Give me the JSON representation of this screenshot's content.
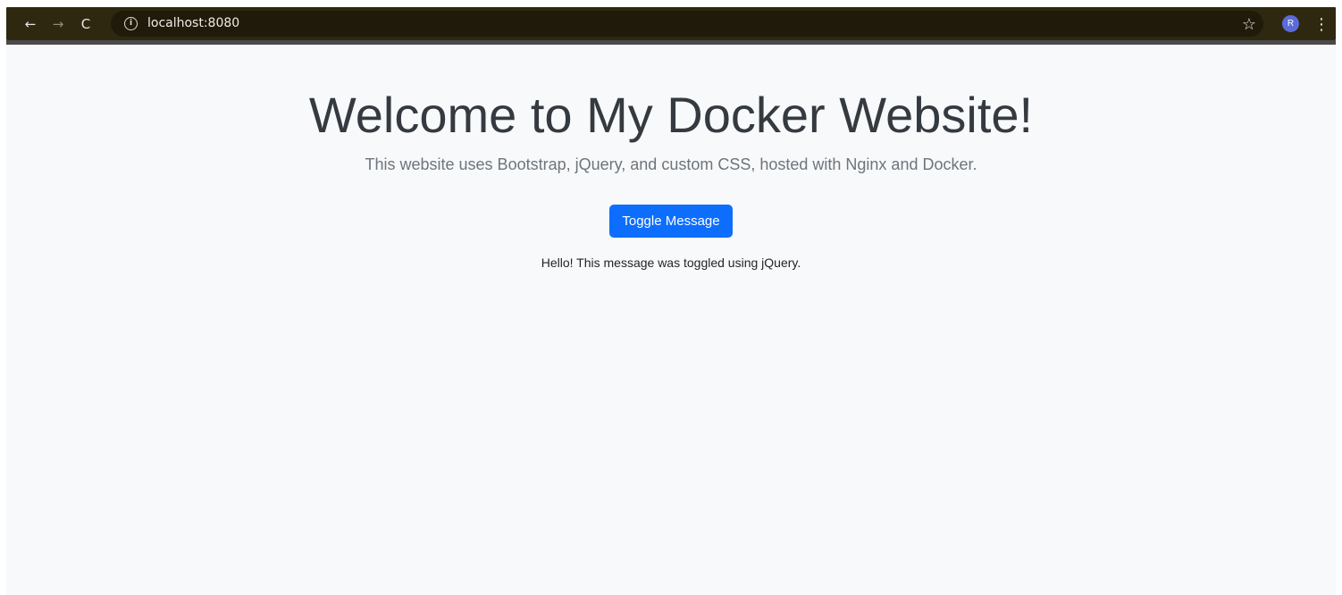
{
  "browser": {
    "url": "localhost:8080",
    "back_glyph": "←",
    "forward_glyph": "→",
    "reload_glyph": "C",
    "info_glyph": "i",
    "star_glyph": "☆",
    "avatar_initial": "R",
    "menu_glyph": "⋮",
    "colors": {
      "toolbar": "#2f2810",
      "omnibox": "#1f1a09",
      "avatar": "#5c6bd8"
    }
  },
  "page": {
    "title": "Welcome to My Docker Website!",
    "subtitle": "This website uses Bootstrap, jQuery, and custom CSS, hosted with Nginx and Docker.",
    "toggle_button_label": "Toggle Message",
    "message": "Hello! This message was toggled using jQuery.",
    "colors": {
      "background": "#f8f9fa",
      "primary_button": "#0d6efd",
      "title_text": "#343a40",
      "subtitle_text": "#6c757d"
    }
  }
}
